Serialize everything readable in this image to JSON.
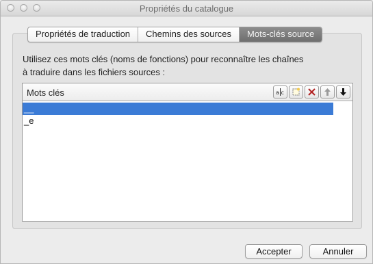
{
  "window": {
    "title": "Propriétés du catalogue"
  },
  "tabs": [
    {
      "label": "Propriétés de traduction",
      "active": false
    },
    {
      "label": "Chemins des sources",
      "active": false
    },
    {
      "label": "Mots-clés source",
      "active": true
    }
  ],
  "panel": {
    "description_line1": "Utilisez ces mots clés (noms de fonctions) pour reconnaître les chaînes",
    "description_line2": "à traduire dans les fichiers sources :"
  },
  "keywords_list": {
    "header": "Mots clés",
    "toolbar": [
      {
        "name": "edit-keyword-icon",
        "glyph": "a|c"
      },
      {
        "name": "new-keyword-icon",
        "glyph": "new"
      },
      {
        "name": "delete-keyword-icon",
        "glyph": "x"
      },
      {
        "name": "move-up-icon",
        "glyph": "up"
      },
      {
        "name": "move-down-icon",
        "glyph": "down"
      }
    ],
    "items": [
      {
        "value": "__",
        "selected": true
      },
      {
        "value": "_e",
        "selected": false
      }
    ]
  },
  "buttons": {
    "accept": "Accepter",
    "cancel": "Annuler"
  },
  "colors": {
    "selection": "#3b7bd6",
    "active_tab": "#7b7b7b",
    "delete_icon": "#b22222"
  }
}
